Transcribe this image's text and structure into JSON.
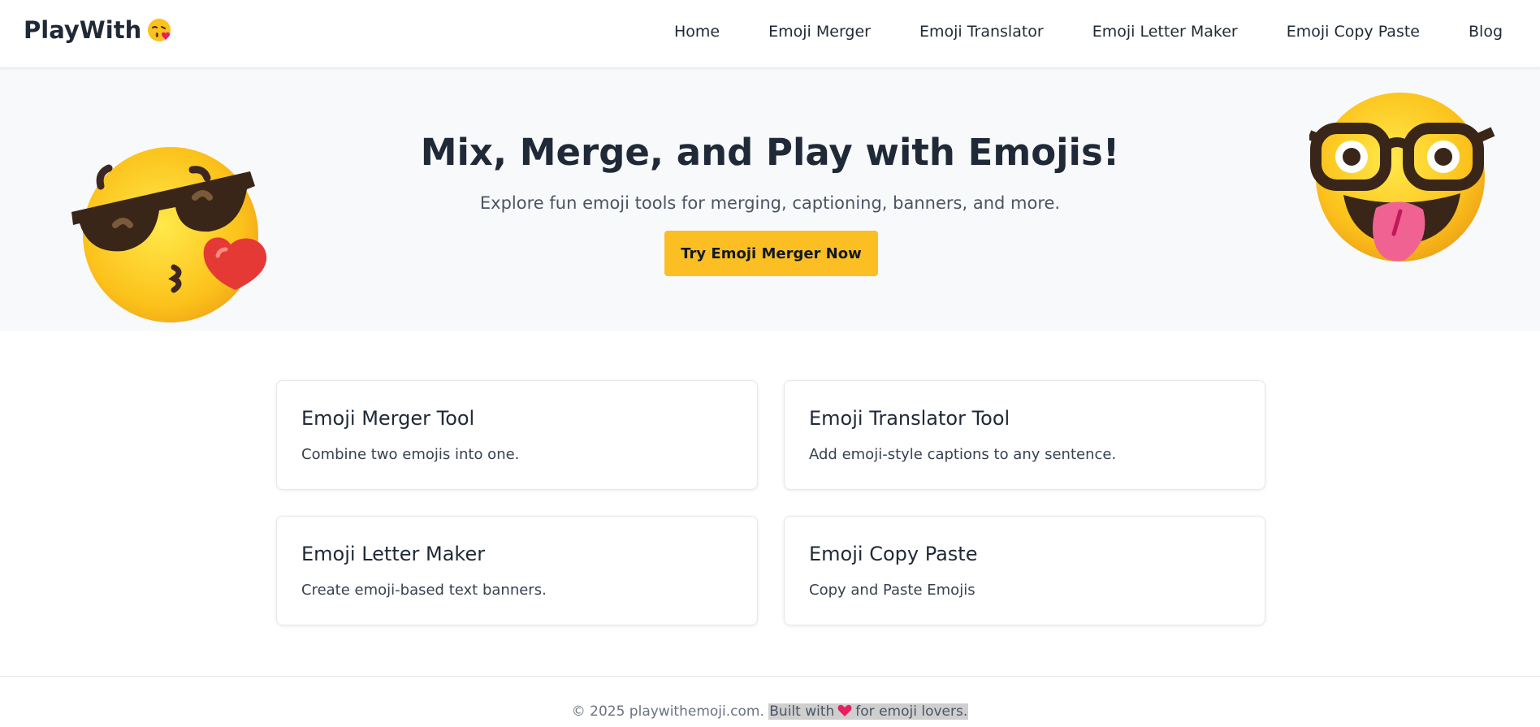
{
  "header": {
    "logo_text": "PlayWith",
    "logo_icon": "kissing-face-emoji",
    "nav": [
      {
        "label": "Home"
      },
      {
        "label": "Emoji Merger"
      },
      {
        "label": "Emoji Translator"
      },
      {
        "label": "Emoji Letter Maker"
      },
      {
        "label": "Emoji Copy Paste"
      },
      {
        "label": "Blog"
      }
    ]
  },
  "hero": {
    "title": "Mix, Merge, and Play with Emojis!",
    "subtitle": "Explore fun emoji tools for merging, captioning, banners, and more.",
    "cta_label": "Try Emoji Merger Now",
    "left_emoji": "cool-kissing-face-emoji",
    "right_emoji": "nerd-tongue-face-emoji",
    "background": "#f8f9fb",
    "cta_color": "#fbbf24"
  },
  "cards": [
    {
      "title": "Emoji Merger Tool",
      "description": "Combine two emojis into one."
    },
    {
      "title": "Emoji Translator Tool",
      "description": "Add emoji-style captions to any sentence."
    },
    {
      "title": "Emoji Letter Maker",
      "description": "Create emoji-based text banners."
    },
    {
      "title": "Emoji Copy Paste",
      "description": "Copy and Paste Emojis"
    }
  ],
  "footer": {
    "prefix": "© 2025 playwithemoji.com.",
    "built_with": "Built with",
    "heart_icon": "pink-heart-icon",
    "suffix": "for emoji lovers."
  }
}
